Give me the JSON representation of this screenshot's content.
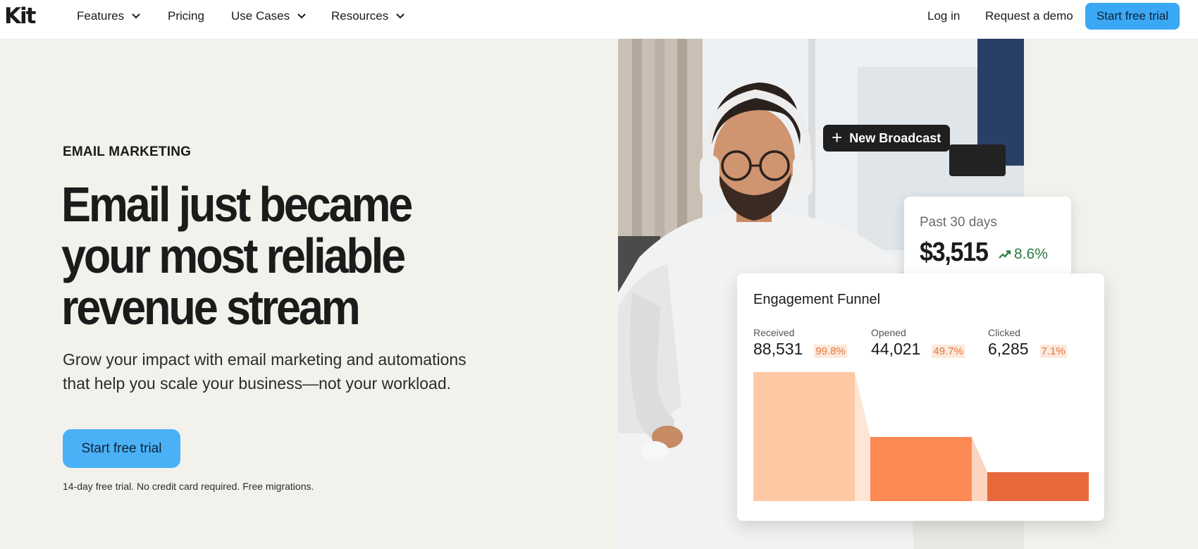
{
  "nav": {
    "logo": "Kit",
    "items": [
      {
        "label": "Features",
        "has_dropdown": true
      },
      {
        "label": "Pricing",
        "has_dropdown": false
      },
      {
        "label": "Use Cases",
        "has_dropdown": true
      },
      {
        "label": "Resources",
        "has_dropdown": true
      }
    ],
    "login": "Log in",
    "demo": "Request a demo",
    "cta": "Start free trial"
  },
  "hero": {
    "eyebrow": "EMAIL MARKETING",
    "headline_lines": [
      "Email just became",
      "your most reliable",
      "revenue stream"
    ],
    "subhead_lines": [
      "Grow your impact with email marketing and automations",
      "that help you scale your business—not your workload."
    ],
    "cta": "Start free trial",
    "fineprint": "14-day free trial. No credit card required. Free migrations."
  },
  "broadcast_chip": {
    "icon": "plus-icon",
    "label": "New Broadcast"
  },
  "stat_card": {
    "label": "Past 30 days",
    "value": "$3,515",
    "trend_icon": "trending-up-icon",
    "trend": "8.6%"
  },
  "funnel": {
    "title": "Engagement Funnel",
    "metrics": [
      {
        "label": "Received",
        "value": "88,531",
        "pct": "99.8%"
      },
      {
        "label": "Opened",
        "value": "44,021",
        "pct": "49.7%"
      },
      {
        "label": "Clicked",
        "value": "6,285",
        "pct": "7.1%"
      }
    ]
  },
  "chart_data": {
    "type": "bar",
    "categories": [
      "Received",
      "Opened",
      "Clicked"
    ],
    "values": [
      88531,
      44021,
      6285
    ],
    "colors": [
      "#fdc9a5",
      "#fd8a55",
      "#e86a3c"
    ],
    "connector_colors": [
      "#fde6d6",
      "#fdd4bd"
    ],
    "ylim": [
      0,
      88531
    ]
  },
  "colors": {
    "accent": "#3ba8f5",
    "background": "#f3f1ec",
    "trend_up": "#2a7b3e",
    "pct_text": "#e0783f"
  }
}
